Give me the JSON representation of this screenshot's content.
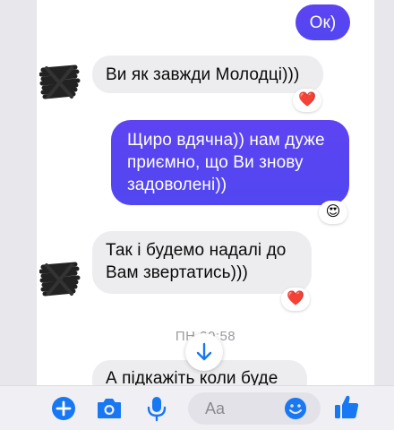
{
  "conversation": {
    "messages": [
      {
        "id": "m1",
        "direction": "outgoing",
        "text": "Ок)"
      },
      {
        "id": "m2",
        "direction": "incoming",
        "text": "Ви як завжди Молодці)))",
        "reaction": "❤️"
      },
      {
        "id": "m3",
        "direction": "outgoing",
        "lines": [
          "Щиро вдячна)) нам дуже",
          "приємно, що Ви знову",
          "задоволені))"
        ],
        "reaction": "😍"
      },
      {
        "id": "m4",
        "direction": "incoming",
        "lines": [
          "Так і будемо надалі до",
          "Вам звертатись)))"
        ],
        "reaction": "❤️"
      },
      {
        "id": "m5",
        "direction": "incoming",
        "text": "А підкажіть коли буде"
      }
    ],
    "timestamp": "ПН 20:58"
  },
  "composer": {
    "placeholder": "Aa",
    "icons": [
      "plus-circle-icon",
      "camera-icon",
      "microphone-icon",
      "emoji-icon",
      "thumbs-up-icon"
    ]
  },
  "colors": {
    "outgoing_bubble": "#5a44f2",
    "incoming_bubble": "#ededf0",
    "accent_blue": "#1877f2",
    "heart_red": "#e8213d"
  }
}
